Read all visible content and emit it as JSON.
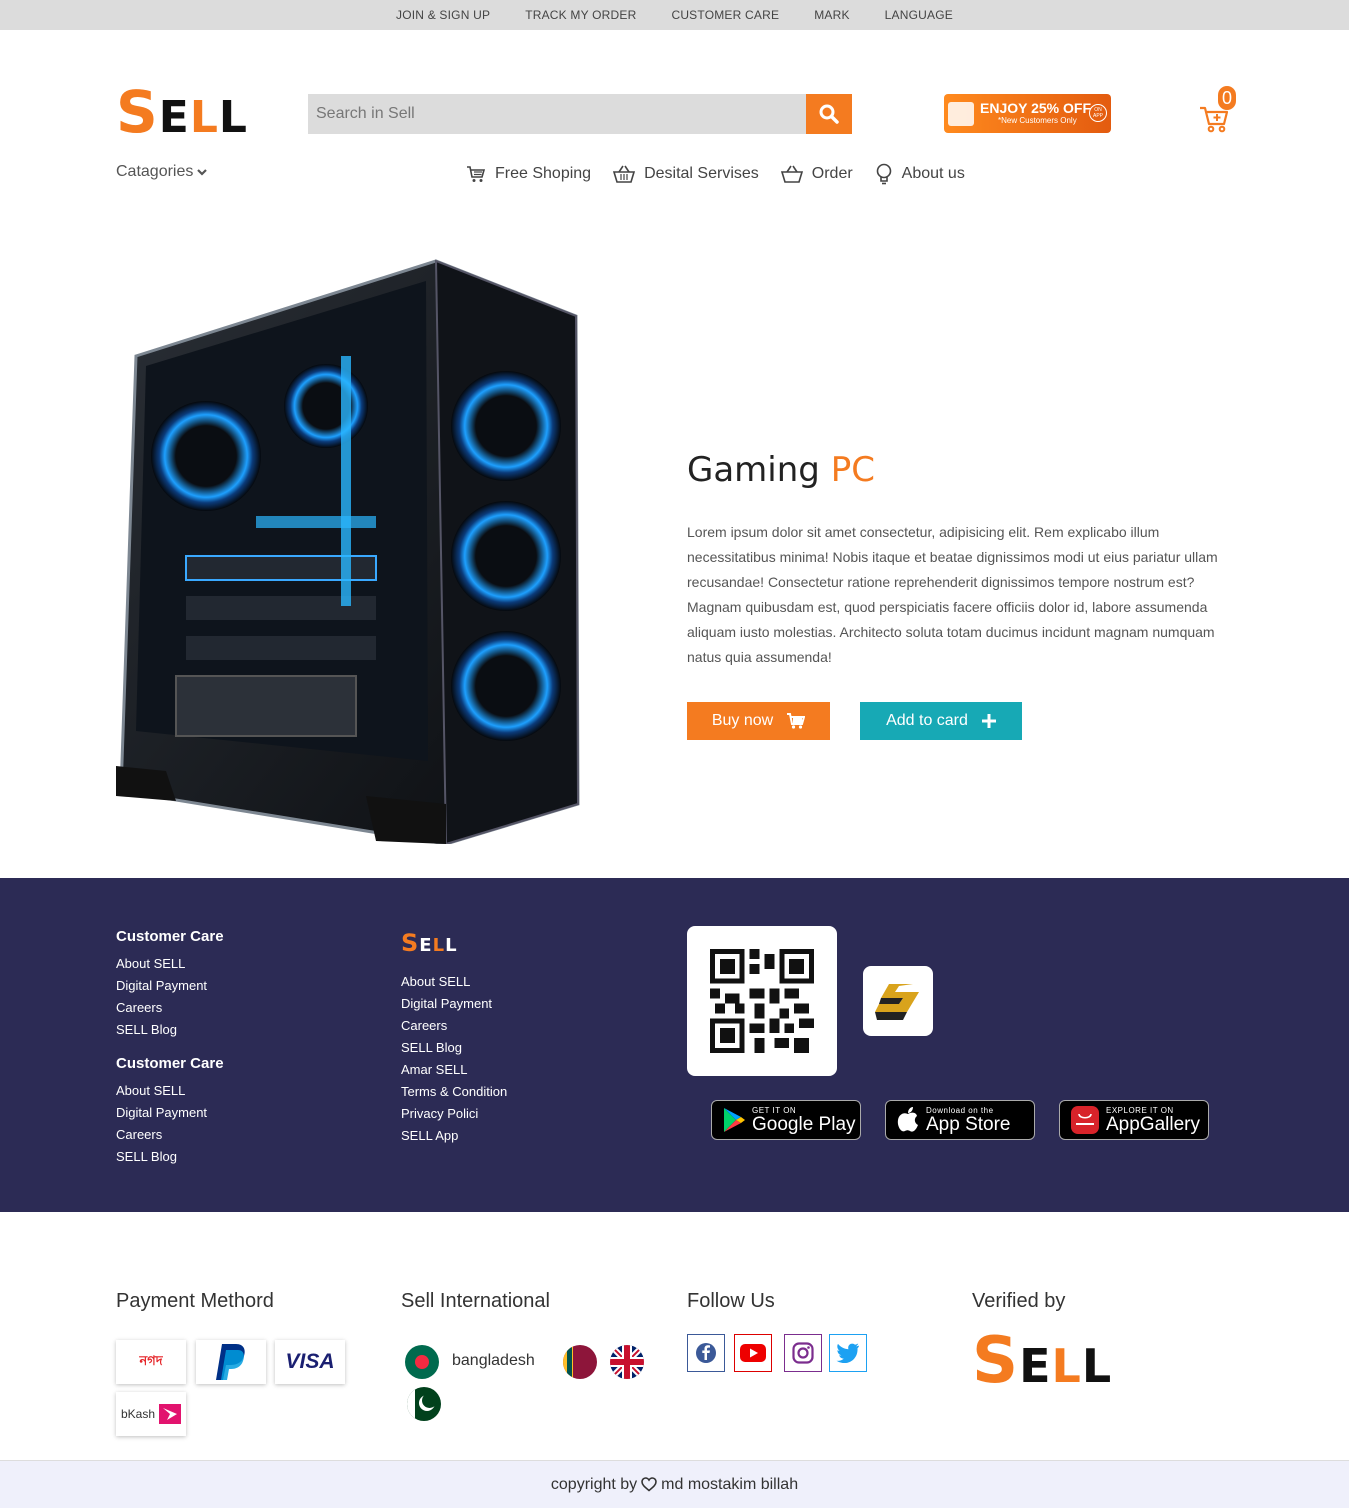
{
  "topbar": {
    "links": [
      "JOIN & SIGN UP",
      "TRACK MY ORDER",
      "CUSTOMER CARE",
      "MARK",
      "LANGUAGE"
    ]
  },
  "brand": {
    "s": "S",
    "e": "E",
    "l1": "L",
    "l2": "L",
    "orange": "#f47b20",
    "dark": "#111111",
    "teal": "#17a9b5",
    "footer_bg": "#2c2b55"
  },
  "search": {
    "placeholder": "Search in Sell",
    "icon": "search-icon"
  },
  "promo": {
    "headline": "ENJOY 25% OFF",
    "subline": "*New Customers Only",
    "badge": "ON APP"
  },
  "cart": {
    "count": "0",
    "icon": "cart-icon"
  },
  "categories": {
    "label": "Catagories",
    "icon": "chevron-down-icon"
  },
  "nav": [
    {
      "label": "Free Shoping",
      "icon": "cart-icon"
    },
    {
      "label": "Desital Servises",
      "icon": "basket-icon"
    },
    {
      "label": "Order",
      "icon": "basket-icon"
    },
    {
      "label": "About us",
      "icon": "lightbulb-icon"
    }
  ],
  "product": {
    "title_main": "Gaming",
    "title_accent": "PC",
    "description": "Lorem ipsum dolor sit amet consectetur, adipisicing elit. Rem explicabo illum necessitatibus minima! Nobis itaque et beatae dignissimos modi ut eius pariatur ullam recusandae! Consectetur ratione reprehenderit dignissimos tempore nostrum est? Magnam quibusdam est, quod perspiciatis facere officiis dolor id, labore assumenda aliquam iusto molestias. Architecto soluta totam ducimus incidunt magnam numquam natus quia assumenda!",
    "buy_label": "Buy now",
    "add_label": "Add to card"
  },
  "footer": {
    "col1": {
      "sections": [
        {
          "heading": "Customer Care",
          "links": [
            "About SELL",
            "Digital Payment",
            "Careers",
            "SELL Blog"
          ]
        },
        {
          "heading": "Customer Care",
          "links": [
            "About SELL",
            "Digital Payment",
            "Careers",
            "SELL Blog"
          ]
        }
      ]
    },
    "col2": {
      "links": [
        "About SELL",
        "Digital Payment",
        "Careers",
        "SELL Blog",
        "Amar SELL",
        "Terms & Condition",
        "Privacy Polici",
        "SELL App"
      ]
    },
    "stores": [
      {
        "small": "GET IT ON",
        "big": "Google Play",
        "icon": "google-play-icon"
      },
      {
        "small": "Download on the",
        "big": "App Store",
        "icon": "apple-icon"
      },
      {
        "small": "EXPLORE IT ON",
        "big": "AppGallery",
        "icon": "huawei-icon"
      }
    ]
  },
  "bottom": {
    "payment": {
      "heading": "Payment Methord",
      "methods": [
        "নগদ",
        "PayPal",
        "VISA",
        "bKash"
      ]
    },
    "international": {
      "heading": "Sell International",
      "broken_image_alt": "bangladesh"
    },
    "follow": {
      "heading": "Follow Us",
      "networks": [
        "facebook-icon",
        "youtube-icon",
        "instagram-icon",
        "twitter-icon"
      ]
    },
    "verified": {
      "heading": "Verified by"
    }
  },
  "copyright": {
    "prefix": "copyright by",
    "author": "md mostakim billah"
  }
}
